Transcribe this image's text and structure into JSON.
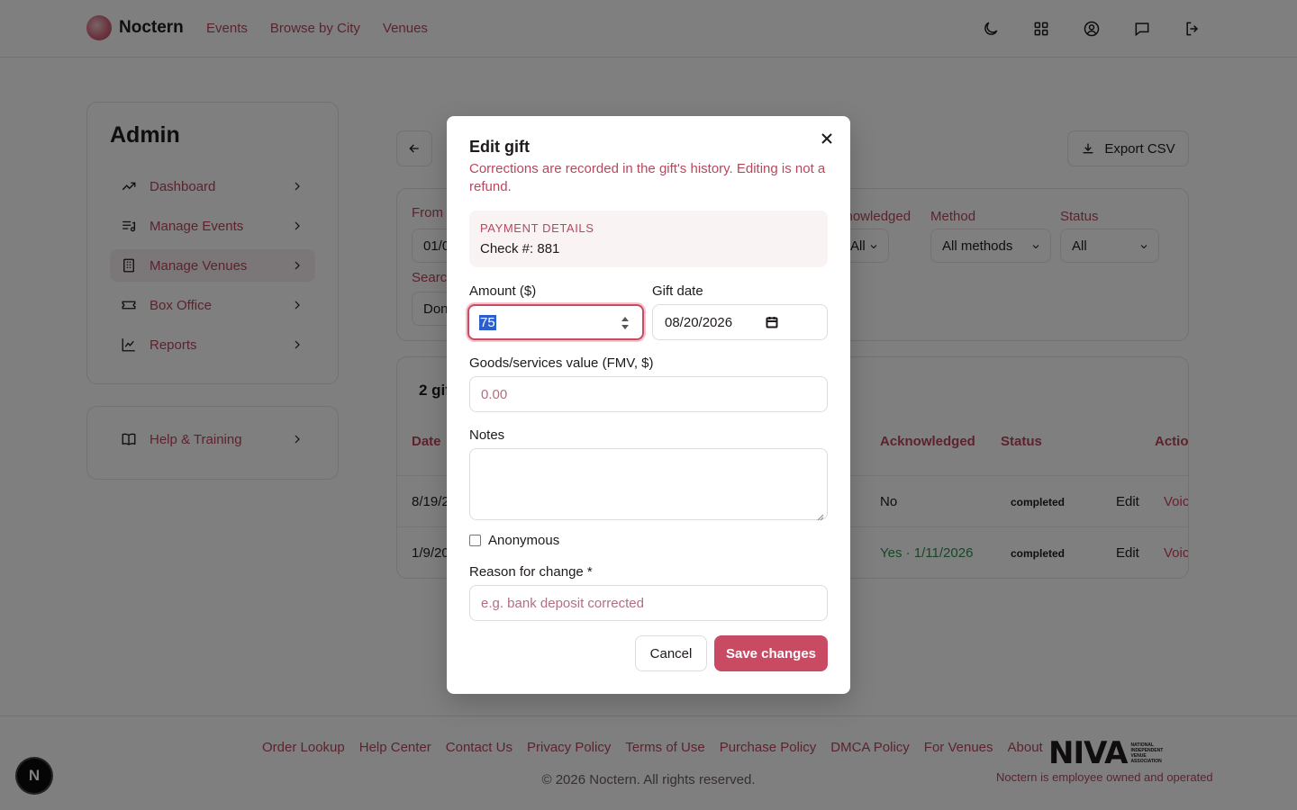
{
  "nav": {
    "brand": "Noctern",
    "links": [
      "Events",
      "Browse by City",
      "Venues"
    ],
    "icons": [
      "moon-icon",
      "grid-icon",
      "account-icon",
      "chat-icon",
      "logout-icon"
    ]
  },
  "sidebar": {
    "title": "Admin",
    "items": [
      {
        "label": "Dashboard",
        "icon": "trend-icon"
      },
      {
        "label": "Manage Events",
        "icon": "music-list-icon"
      },
      {
        "label": "Manage Venues",
        "icon": "building-icon"
      },
      {
        "label": "Box Office",
        "icon": "ticket-icon"
      },
      {
        "label": "Reports",
        "icon": "chart-icon"
      }
    ],
    "help_label": "Help & Training"
  },
  "main": {
    "export_label": "Export CSV",
    "filters": {
      "from_label": "From",
      "from_value": "01/0",
      "search_label": "Searc",
      "search_value": "Don",
      "ack_label": "knowledged",
      "ack_value": "All",
      "method_label": "Method",
      "method_value": "All methods",
      "status_label": "Status",
      "status_value": "All"
    },
    "gifts": {
      "count_label": "2 gif",
      "headers": {
        "date": "Date",
        "acknowledged": "Acknowledged",
        "status": "Status",
        "actions": "Actio"
      },
      "rows": [
        {
          "date": "8/19/2",
          "acknowledged": "No",
          "status": "completed",
          "edit": "Edit",
          "void": "Voic"
        },
        {
          "date": "1/9/20",
          "acknowledged": "Yes · 1/11/2026",
          "status": "completed",
          "edit": "Edit",
          "void": "Voic"
        }
      ]
    }
  },
  "modal": {
    "title": "Edit gift",
    "description": "Corrections are recorded in the gift's history. Editing is not a refund.",
    "payment_details_title": "PAYMENT DETAILS",
    "payment_details_value": "Check #: 881",
    "amount_label": "Amount ($)",
    "amount_value": "75",
    "gift_date_label": "Gift date",
    "gift_date_value": "08/20/2026",
    "fmv_label": "Goods/services value (FMV, $)",
    "fmv_placeholder": "0.00",
    "notes_label": "Notes",
    "anonymous_label": "Anonymous",
    "anonymous_checked": false,
    "reason_label": "Reason for change *",
    "reason_placeholder": "e.g. bank deposit corrected",
    "cancel_label": "Cancel",
    "save_label": "Save changes"
  },
  "footer": {
    "links": [
      "Order Lookup",
      "Help Center",
      "Contact Us",
      "Privacy Policy",
      "Terms of Use",
      "Purchase Policy",
      "DMCA Policy",
      "For Venues",
      "About"
    ],
    "copyright": "© 2026 Noctern. All rights reserved.",
    "niva_logo": "NIVA",
    "niva_sub": "NATIONAL INDEPENDENT VENUE ASSOCIATION",
    "employee_note": "Noctern is employee owned and operated"
  },
  "colors": {
    "accent": "#c94b63",
    "link": "#b8475c",
    "overlay": "rgba(0,0,0,0.5)"
  }
}
